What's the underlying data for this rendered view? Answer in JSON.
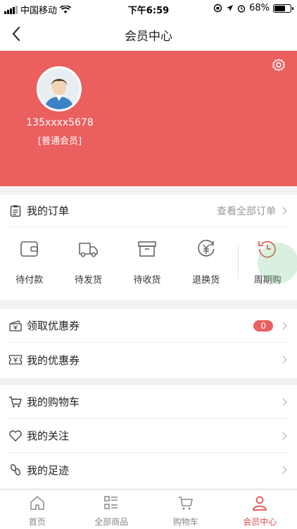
{
  "status_bar": {
    "carrier": "中国移动",
    "time": "下午6:59",
    "battery": "68%",
    "battery_level": 0.68
  },
  "nav": {
    "title": "会员中心",
    "back_icon": "chevron-left-icon"
  },
  "profile": {
    "phone": "135xxxx5678",
    "level": "[普通会员]",
    "settings_icon": "gear-icon",
    "avatar_icon": "avatar-icon"
  },
  "orders": {
    "title": "我的订单",
    "view_all": "查看全部订单",
    "items": [
      {
        "label": "待付款",
        "icon": "wallet-icon"
      },
      {
        "label": "待发货",
        "icon": "truck-icon"
      },
      {
        "label": "待收货",
        "icon": "box-icon"
      },
      {
        "label": "退换货",
        "icon": "yen-refresh-icon"
      },
      {
        "label": "周期购",
        "icon": "clock-refresh-icon"
      }
    ]
  },
  "coupons": {
    "get_label": "领取优惠券",
    "get_count": "0",
    "mine_label": "我的优惠券"
  },
  "my": {
    "cart": "我的购物车",
    "follow": "我的关注",
    "footprint": "我的足迹"
  },
  "tabs": [
    {
      "label": "首页",
      "icon": "home-icon"
    },
    {
      "label": "全部商品",
      "icon": "grid-list-icon"
    },
    {
      "label": "购物车",
      "icon": "cart-icon"
    },
    {
      "label": "会员中心",
      "icon": "user-icon",
      "active": true
    }
  ],
  "colors": {
    "brand": "#ec5f5f",
    "active_tab": "#e34b4b"
  }
}
